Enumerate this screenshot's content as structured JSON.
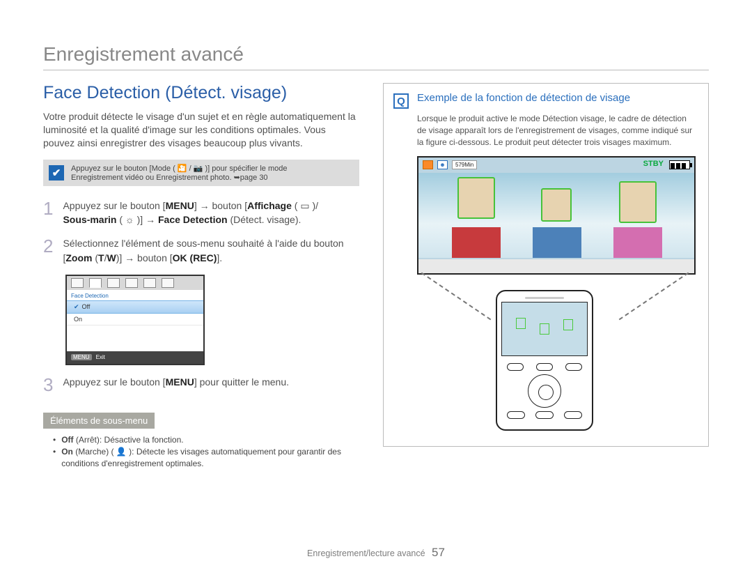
{
  "doc_title": "Enregistrement avancé",
  "section_title": "Face Detection (Détect. visage)",
  "intro": "Votre produit détecte le visage d'un sujet et en règle automatiquement la luminosité et la qualité d'image sur les conditions optimales. Vous pouvez ainsi enregistrer des visages beaucoup plus vivants.",
  "note": {
    "line1": "Appuyez sur le bouton [Mode ( 🎦 / 📷 )] pour spécifier le mode",
    "line2": "Enregistrement vidéo ou Enregistrement photo. ➥page 30"
  },
  "steps": [
    {
      "num": "1",
      "html_parts": {
        "p1": "Appuyez sur le bouton [",
        "b1": "MENU",
        "p2": "] → bouton [",
        "b2": "Affichage",
        "p3": " ( ▭ )/ ",
        "b3": "Sous-marin",
        "p4": " ( ☼ )] → ",
        "b4": "Face Detection",
        "p5": " (Détect. visage)."
      }
    },
    {
      "num": "2",
      "html_parts": {
        "p1": "Sélectionnez l'élément de sous-menu souhaité à l'aide du bouton [",
        "b1": "Zoom",
        "p2": " (",
        "b2": "T",
        "p3": "/",
        "b3": "W",
        "p4": ")] → bouton [",
        "b4": "OK (REC)",
        "p5": "]."
      }
    },
    {
      "num": "3",
      "html_parts": {
        "p1": "Appuyez sur le bouton [",
        "b1": "MENU",
        "p2": "] pour quitter le menu."
      }
    }
  ],
  "menu_screen": {
    "title": "Face Detection",
    "opt_off": "Off",
    "opt_on": "On",
    "exit_label": "Exit",
    "menu_badge": "MENU"
  },
  "submenu": {
    "header": "Éléments de sous-menu",
    "off_label": "Off",
    "off_desc": " (Arrêt): Désactive la fonction.",
    "on_label": "On",
    "on_desc": " (Marche) ( 👤 ): Détecte les visages automatiquement pour garantir des conditions d'enregistrement optimales."
  },
  "example": {
    "title": "Exemple de la fonction de détection de visage",
    "desc": "Lorsque le produit active le mode Détection visage, le cadre de détection de visage apparaît lors de l'enregistrement de visages, comme indiqué sur la figure ci-dessous. Le produit peut détecter trois visages maximum.",
    "overlay_min": "579Min",
    "overlay_stby": "STBY"
  },
  "footer": {
    "text": "Enregistrement/lecture avancé",
    "page": "57"
  }
}
